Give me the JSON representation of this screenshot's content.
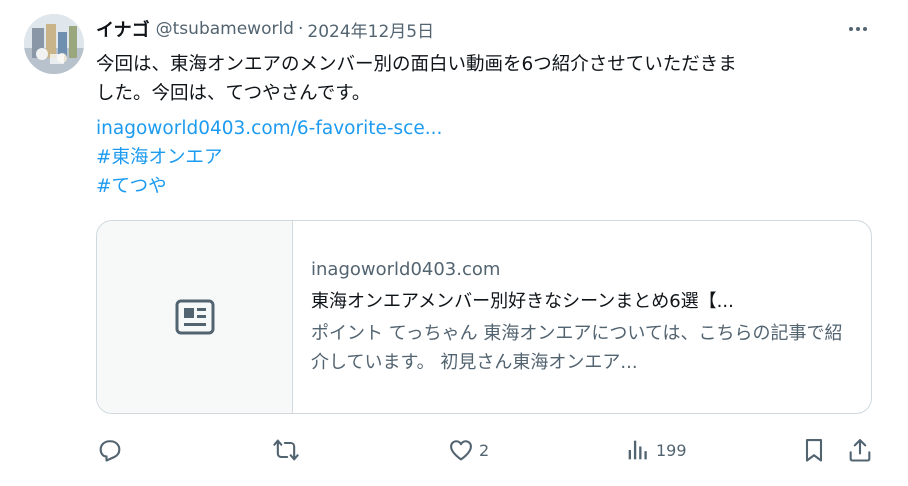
{
  "tweet": {
    "author": {
      "display_name": "イナゴ",
      "handle": "@tsubameworld"
    },
    "separator": "·",
    "date": "2024年12月5日",
    "text_line1": "今回は、東海オンエアのメンバー別の面白い動画を6つ紹介させていただきま",
    "text_line2": "した。今回は、てつやさんです。",
    "link": "inagoworld0403.com/6-favorite-sce...",
    "hashtags": [
      "#東海オンエア",
      "#てつや"
    ]
  },
  "card": {
    "domain": "inagoworld0403.com",
    "title": "東海オンエアメンバー別好きなシーンまとめ6選【...",
    "description": "ポイント てっちゃん 東海オンエアについては、こちらの記事で紹介しています。 初見さん東海オンエア..."
  },
  "actions": {
    "reply_count": "",
    "retweet_count": "",
    "like_count": "2",
    "views_count": "199"
  },
  "icons": {
    "more": "more-dots-icon",
    "article": "article-icon",
    "reply": "reply-icon",
    "retweet": "retweet-icon",
    "like": "like-icon",
    "views": "views-icon",
    "bookmark": "bookmark-icon",
    "share": "share-icon"
  },
  "colors": {
    "text": "#0f1419",
    "secondary": "#536471",
    "link": "#1d9bf0",
    "border": "#cfd9de",
    "card_thumb_bg": "#f7f9f9"
  }
}
